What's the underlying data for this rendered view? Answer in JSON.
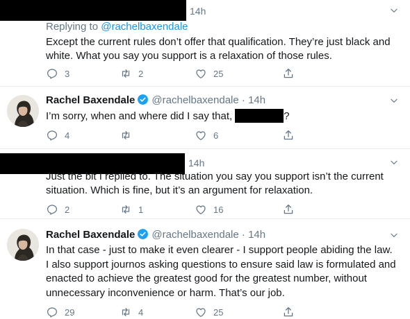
{
  "tweets": [
    {
      "time": "14h",
      "replying_prefix": "Replying to ",
      "replying_handle": "@rachelbaxendale",
      "lines": [
        "Except the current rules don’t offer that qualification. They’re just black and",
        "white. What you say you support is a relaxation of those rules."
      ],
      "replies": "3",
      "retweets": "2",
      "likes": "25"
    },
    {
      "name": "Rachel Baxendale",
      "handle": "@rachelbaxendale",
      "sep": "·",
      "time": "14h",
      "text_before": "I’m sorry, when and where did I say that,",
      "text_after": "?",
      "replies": "4",
      "retweets": "",
      "likes": "6"
    },
    {
      "time": "14h",
      "lines": [
        "Just the bit I replied to. The situation you say you support isn’t the current",
        "situation. Which is fine, but it’s an argument for relaxation."
      ],
      "replies": "2",
      "retweets": "1",
      "likes": "16"
    },
    {
      "name": "Rachel Baxendale",
      "handle": "@rachelbaxendale",
      "sep": "·",
      "time": "14h",
      "lines": [
        "In that case - just to make it even clearer - I support people abiding the law.",
        "I also support journos asking questions to ensure said law is formulated and",
        "enacted to achieve the greatest good for the greatest number, without",
        "unnecessary inconvenience or harm. That’s our job."
      ],
      "replies": "29",
      "retweets": "4",
      "likes": "25"
    }
  ],
  "colors": {
    "text": "#14171a",
    "secondary": "#657786",
    "link": "#1b95e0",
    "verified": "#1da1f2",
    "divider": "#e6ecf0"
  },
  "icons": [
    "reply-icon",
    "retweet-icon",
    "like-icon",
    "share-icon",
    "chevron-down-icon",
    "verified-badge-icon"
  ]
}
